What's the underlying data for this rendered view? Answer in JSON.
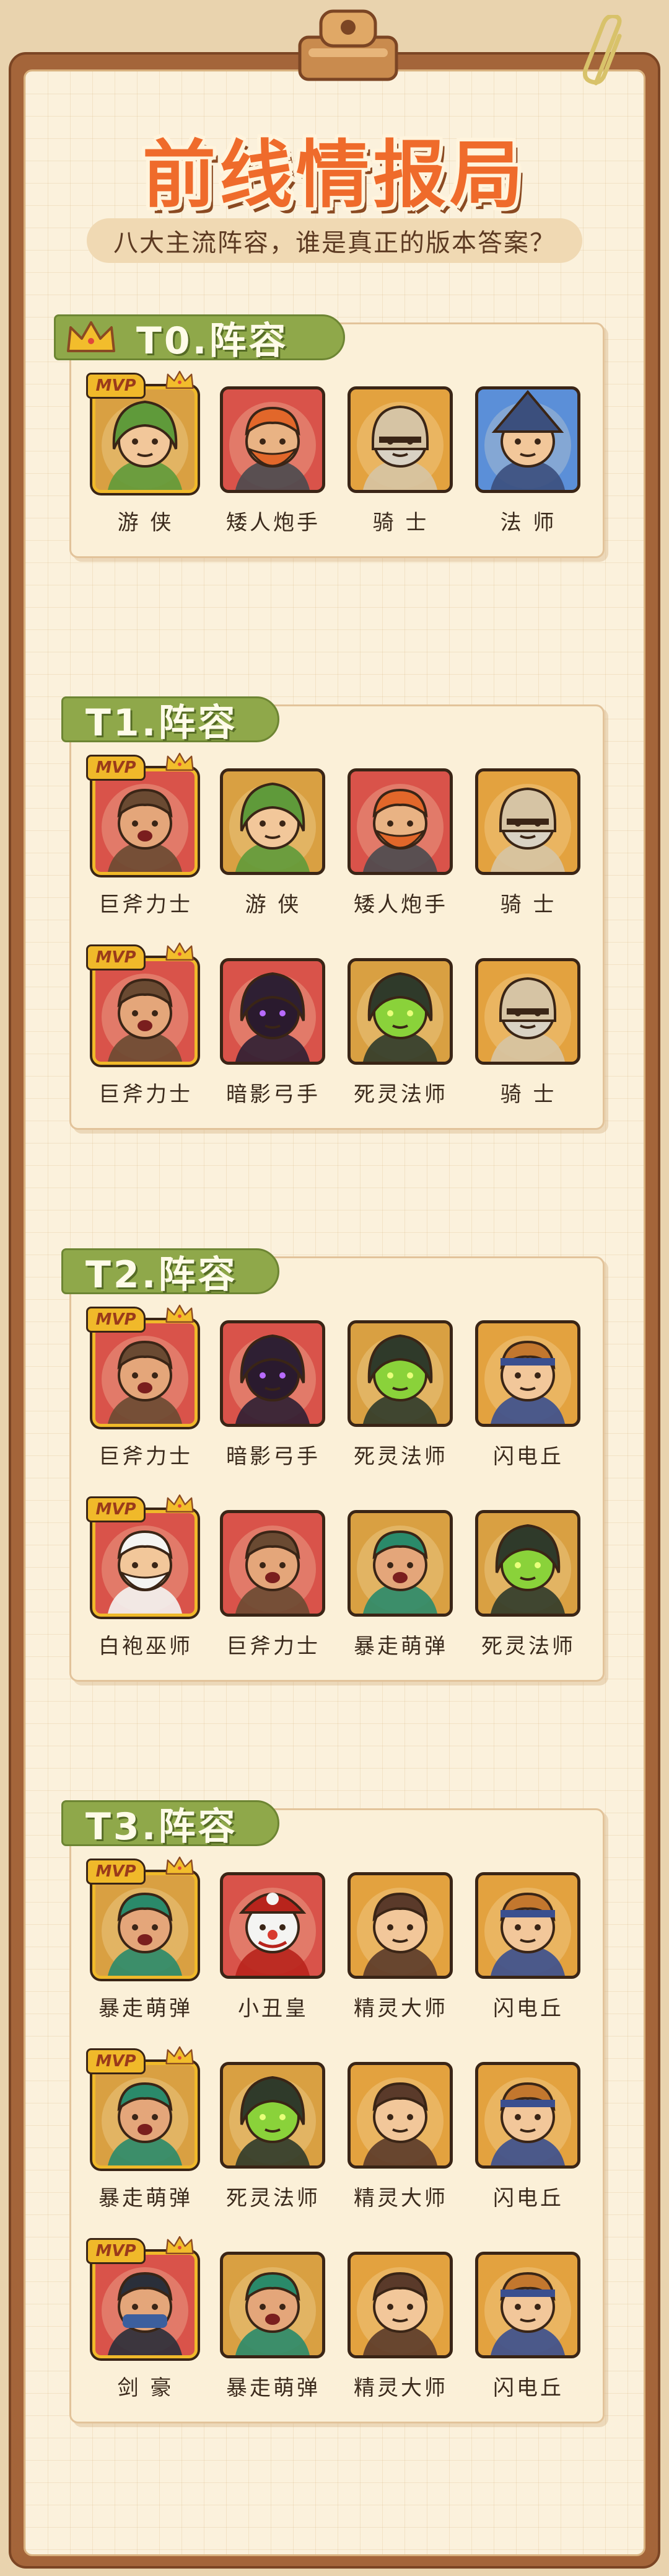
{
  "header": {
    "title": "前线情报局",
    "subtitle": "八大主流阵容，谁是真正的版本答案？"
  },
  "tiers": [
    {
      "label": "T0.阵容",
      "has_crown": true,
      "rows": [
        [
          {
            "name": "游 侠",
            "icon": "ranger-portrait",
            "mvp": true
          },
          {
            "name": "矮人炮手",
            "icon": "dwarf-gunner-portrait",
            "mvp": false
          },
          {
            "name": "骑 士",
            "icon": "knight-portrait",
            "mvp": false
          },
          {
            "name": "法 师",
            "icon": "wizard-portrait",
            "mvp": false
          }
        ]
      ]
    },
    {
      "label": "T1.阵容",
      "has_crown": false,
      "rows": [
        [
          {
            "name": "巨斧力士",
            "icon": "axe-brute-portrait",
            "mvp": true
          },
          {
            "name": "游 侠",
            "icon": "ranger-portrait",
            "mvp": false
          },
          {
            "name": "矮人炮手",
            "icon": "dwarf-gunner-portrait",
            "mvp": false
          },
          {
            "name": "骑 士",
            "icon": "knight-portrait",
            "mvp": false
          }
        ],
        [
          {
            "name": "巨斧力士",
            "icon": "axe-brute-portrait",
            "mvp": true
          },
          {
            "name": "暗影弓手",
            "icon": "shadow-archer-portrait",
            "mvp": false
          },
          {
            "name": "死灵法师",
            "icon": "necromancer-portrait",
            "mvp": false
          },
          {
            "name": "骑 士",
            "icon": "knight-portrait",
            "mvp": false
          }
        ]
      ]
    },
    {
      "label": "T2.阵容",
      "has_crown": false,
      "rows": [
        [
          {
            "name": "巨斧力士",
            "icon": "axe-brute-portrait",
            "mvp": true
          },
          {
            "name": "暗影弓手",
            "icon": "shadow-archer-portrait",
            "mvp": false
          },
          {
            "name": "死灵法师",
            "icon": "necromancer-portrait",
            "mvp": false
          },
          {
            "name": "闪电丘",
            "icon": "lightning-hillman-portrait",
            "mvp": false
          }
        ],
        [
          {
            "name": "白袍巫师",
            "icon": "white-robe-wizard-portrait",
            "mvp": true
          },
          {
            "name": "巨斧力士",
            "icon": "axe-brute-portrait",
            "mvp": false
          },
          {
            "name": "暴走萌弹",
            "icon": "rampage-bomber-portrait",
            "mvp": false
          },
          {
            "name": "死灵法师",
            "icon": "necromancer-portrait",
            "mvp": false
          }
        ]
      ]
    },
    {
      "label": "T3.阵容",
      "has_crown": false,
      "rows": [
        [
          {
            "name": "暴走萌弹",
            "icon": "rampage-bomber-portrait",
            "mvp": true
          },
          {
            "name": "小丑皇",
            "icon": "clown-king-portrait",
            "mvp": false
          },
          {
            "name": "精灵大师",
            "icon": "elf-master-portrait",
            "mvp": false
          },
          {
            "name": "闪电丘",
            "icon": "lightning-hillman-portrait",
            "mvp": false
          }
        ],
        [
          {
            "name": "暴走萌弹",
            "icon": "rampage-bomber-portrait",
            "mvp": true
          },
          {
            "name": "死灵法师",
            "icon": "necromancer-portrait",
            "mvp": false
          },
          {
            "name": "精灵大师",
            "icon": "elf-master-portrait",
            "mvp": false
          },
          {
            "name": "闪电丘",
            "icon": "lightning-hillman-portrait",
            "mvp": false
          }
        ],
        [
          {
            "name": "剑 豪",
            "icon": "swordmaster-portrait",
            "mvp": true
          },
          {
            "name": "暴走萌弹",
            "icon": "rampage-bomber-portrait",
            "mvp": false
          },
          {
            "name": "精灵大师",
            "icon": "elf-master-portrait",
            "mvp": false
          },
          {
            "name": "闪电丘",
            "icon": "lightning-hillman-portrait",
            "mvp": false
          }
        ]
      ]
    }
  ],
  "mvp_label": "MVP",
  "colors": {
    "title": "#ef6b2b",
    "tier_label": "#8fa84a",
    "mvp_gold": "#f0b92a",
    "board": "#a4653a"
  }
}
